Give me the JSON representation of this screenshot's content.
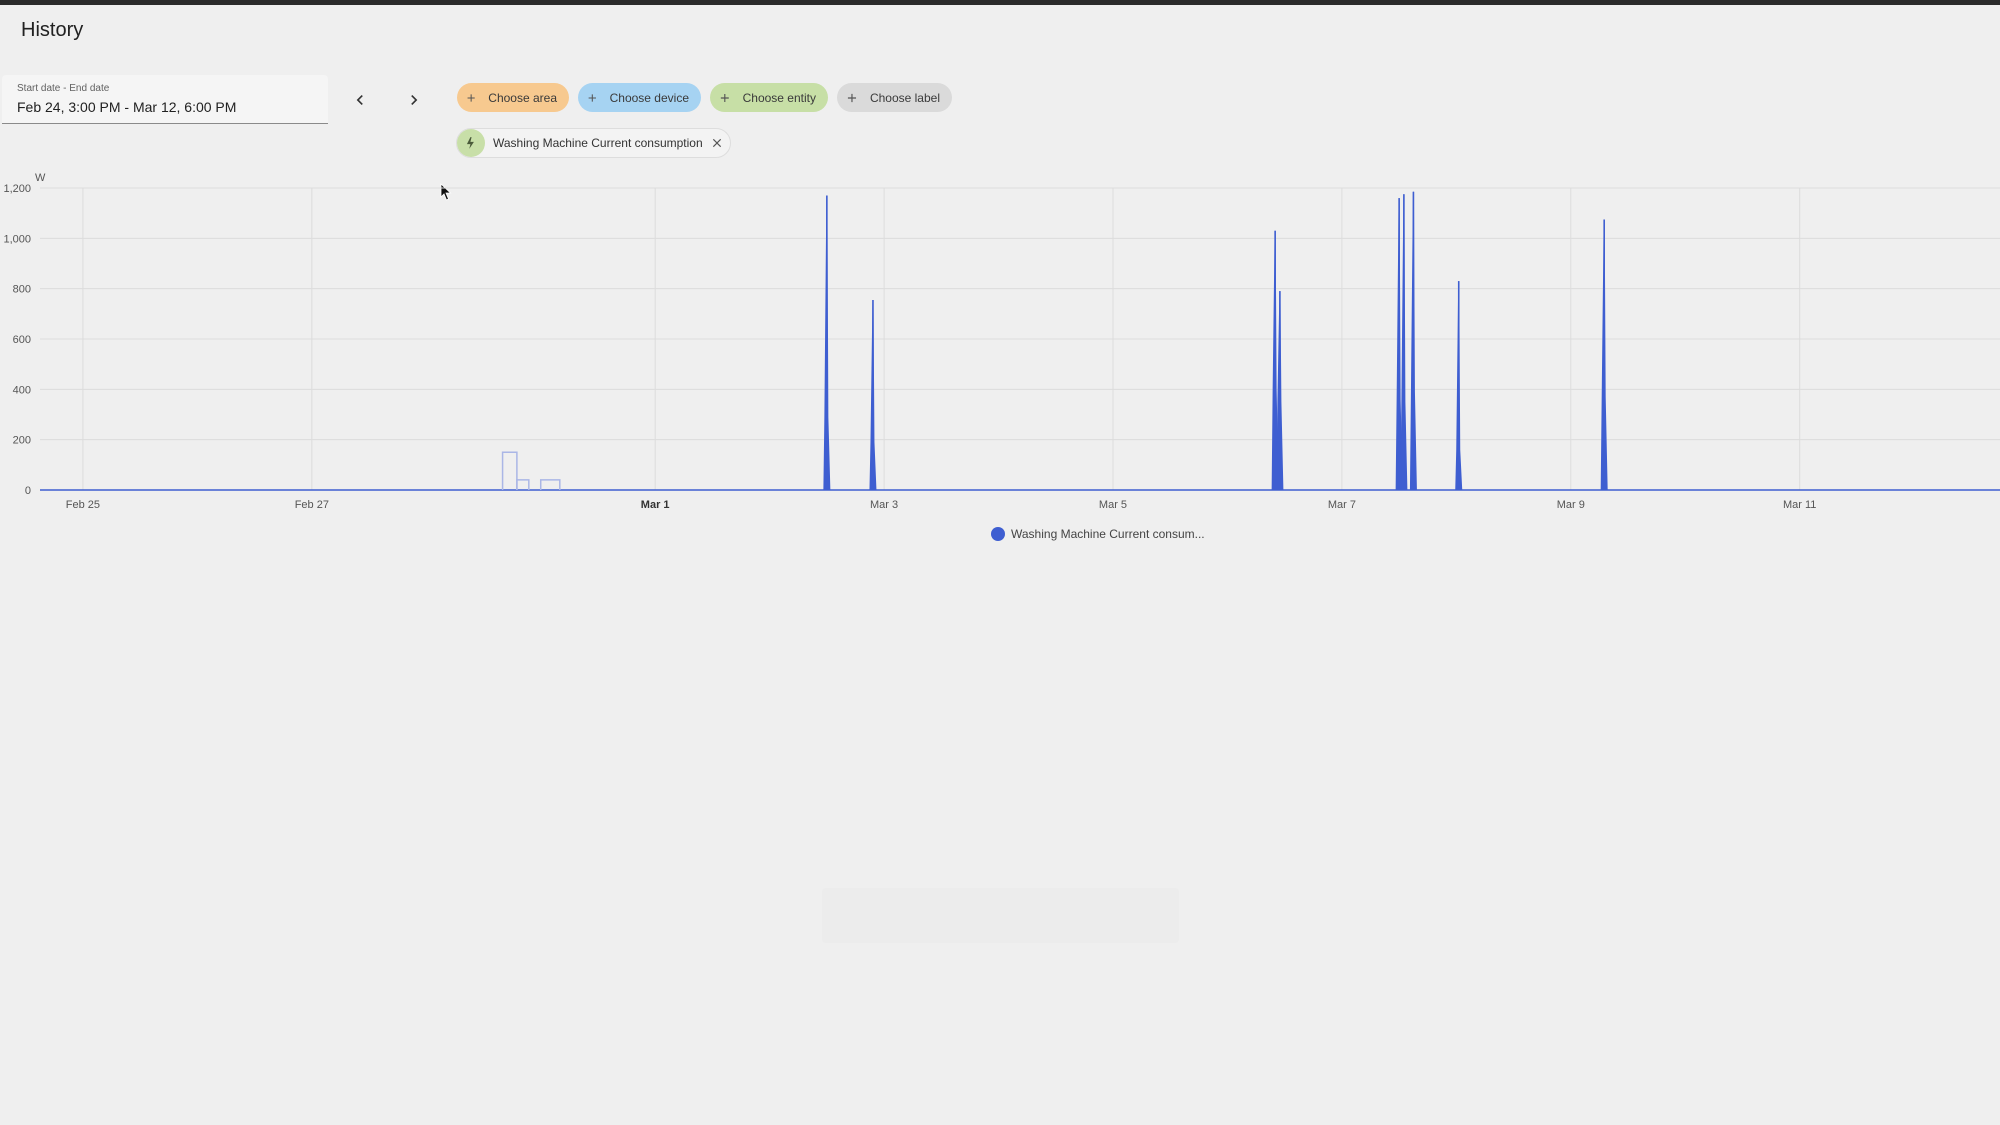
{
  "page": {
    "title": "History"
  },
  "date_picker": {
    "label": "Start date - End date",
    "value": "Feb 24, 3:00 PM - Mar 12, 6:00 PM"
  },
  "navigation": {
    "prev": "previous-range",
    "next": "next-range"
  },
  "target_chips": [
    {
      "key": "area",
      "label": "Choose area",
      "color": "#f7c98f"
    },
    {
      "key": "device",
      "label": "Choose device",
      "color": "#a6d3f2"
    },
    {
      "key": "entity",
      "label": "Choose entity",
      "color": "#c7dfa6"
    },
    {
      "key": "label",
      "label": "Choose label",
      "color": "#dadada"
    }
  ],
  "selected_entity": {
    "label": "Washing Machine Current consumption",
    "icon": "lightning-bolt-icon"
  },
  "legend": {
    "label": "Washing Machine Current consum..."
  },
  "colors": {
    "series": "#3e5ed1",
    "series_faint": "#aab6e6"
  },
  "chart_data": {
    "type": "area",
    "ylabel": "W",
    "ylim": [
      0,
      1200
    ],
    "y_ticks": [
      0,
      200,
      400,
      600,
      800,
      1000,
      1200
    ],
    "y_tick_labels": [
      "0",
      "200",
      "400",
      "600",
      "800",
      "1,000",
      "1,200"
    ],
    "x_range": [
      "2024-02-24T15:00",
      "2024-03-12T18:00"
    ],
    "x_ticks": [
      {
        "date": "2024-02-25T00:00",
        "label": "Feb 25",
        "bold": false
      },
      {
        "date": "2024-02-27T00:00",
        "label": "Feb 27",
        "bold": false
      },
      {
        "date": "2024-03-01T00:00",
        "label": "Mar 1",
        "bold": true
      },
      {
        "date": "2024-03-03T00:00",
        "label": "Mar 3",
        "bold": false
      },
      {
        "date": "2024-03-05T00:00",
        "label": "Mar 5",
        "bold": false
      },
      {
        "date": "2024-03-07T00:00",
        "label": "Mar 7",
        "bold": false
      },
      {
        "date": "2024-03-09T00:00",
        "label": "Mar 9",
        "bold": false
      },
      {
        "date": "2024-03-11T00:00",
        "label": "Mar 11",
        "bold": false
      }
    ],
    "grid": true,
    "legend_position": "bottom-center",
    "series": [
      {
        "name": "Washing Machine Current consumption",
        "faint_steps": [
          {
            "start": "2024-02-28T16:00",
            "end": "2024-02-28T19:00",
            "value": 150
          },
          {
            "start": "2024-02-28T19:00",
            "end": "2024-02-28T21:30",
            "value": 40
          },
          {
            "start": "2024-02-29T00:00",
            "end": "2024-02-29T04:00",
            "value": 40
          }
        ],
        "spikes": [
          {
            "t": "2024-03-02T12:00",
            "peak": 1170,
            "base": 290
          },
          {
            "t": "2024-03-02T21:40",
            "peak": 755,
            "base": 190
          },
          {
            "t": "2024-03-06T10:00",
            "peak": 1030,
            "base": 400
          },
          {
            "t": "2024-03-06T11:00",
            "peak": 790,
            "base": 350
          },
          {
            "t": "2024-03-07T12:00",
            "peak": 1160,
            "base": 360
          },
          {
            "t": "2024-03-07T13:00",
            "peak": 1175,
            "base": 350
          },
          {
            "t": "2024-03-07T15:00",
            "peak": 1185,
            "base": 390
          },
          {
            "t": "2024-03-08T00:30",
            "peak": 830,
            "base": 160
          },
          {
            "t": "2024-03-09T07:00",
            "peak": 1075,
            "base": 370
          }
        ]
      }
    ]
  }
}
